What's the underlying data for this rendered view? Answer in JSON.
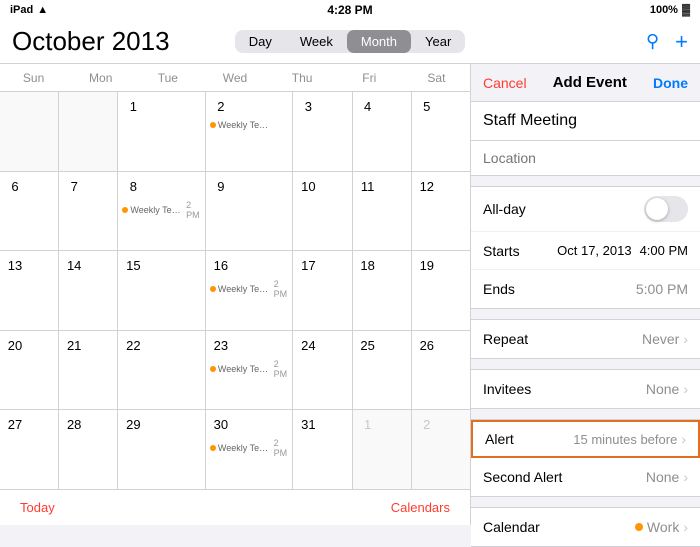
{
  "statusBar": {
    "carrier": "iPad",
    "wifi": "wifi",
    "time": "4:28 PM",
    "battery": "100%"
  },
  "header": {
    "monthTitle": "October 2013",
    "viewButtons": [
      "Day",
      "Week",
      "Month",
      "Year"
    ],
    "activeView": "Month"
  },
  "dayHeaders": [
    "Sun",
    "Mon",
    "Tue",
    "Wed",
    "Thu",
    "Fri",
    "Sat"
  ],
  "calendarRows": [
    [
      {
        "num": "",
        "otherMonth": true
      },
      {
        "num": "",
        "otherMonth": true
      },
      {
        "num": "1",
        "events": []
      },
      {
        "num": "2",
        "events": [
          {
            "text": "Weekly Team...",
            "time": ""
          }
        ]
      },
      {
        "num": "3",
        "events": []
      },
      {
        "num": "4",
        "events": []
      },
      {
        "num": "5",
        "events": []
      }
    ],
    [
      {
        "num": "6",
        "events": []
      },
      {
        "num": "7",
        "events": []
      },
      {
        "num": "8",
        "events": [
          {
            "text": "Weekly Team Me...",
            "time": "2 PM"
          }
        ]
      },
      {
        "num": "9",
        "events": []
      },
      {
        "num": "10",
        "events": []
      },
      {
        "num": "11",
        "events": []
      },
      {
        "num": "12",
        "events": []
      }
    ],
    [
      {
        "num": "13",
        "events": []
      },
      {
        "num": "14",
        "events": []
      },
      {
        "num": "15",
        "events": []
      },
      {
        "num": "16",
        "events": [
          {
            "text": "Weekly Team Me...",
            "time": "2 PM"
          }
        ]
      },
      {
        "num": "17",
        "events": []
      },
      {
        "num": "18",
        "events": []
      },
      {
        "num": "19",
        "events": []
      }
    ],
    [
      {
        "num": "20",
        "events": []
      },
      {
        "num": "21",
        "events": []
      },
      {
        "num": "22",
        "events": []
      },
      {
        "num": "23",
        "events": [
          {
            "text": "Weekly Team Me...",
            "time": "2 PM"
          }
        ]
      },
      {
        "num": "24",
        "events": []
      },
      {
        "num": "25",
        "events": []
      },
      {
        "num": "26",
        "events": []
      }
    ],
    [
      {
        "num": "27",
        "events": []
      },
      {
        "num": "28",
        "events": []
      },
      {
        "num": "29",
        "events": []
      },
      {
        "num": "30",
        "events": [
          {
            "text": "Weekly Team Me...",
            "time": "2 PM"
          }
        ]
      },
      {
        "num": "31",
        "events": []
      },
      {
        "num": "1",
        "otherMonth": true,
        "events": []
      },
      {
        "num": "2",
        "otherMonth": true,
        "events": []
      }
    ]
  ],
  "bottomBar": {
    "todayLabel": "Today",
    "calendarsLabel": "Calendars"
  },
  "eventPanel": {
    "cancelLabel": "Cancel",
    "titleLabel": "Add Event",
    "doneLabel": "Done",
    "eventTitle": "Staff Meeting",
    "locationPlaceholder": "Location",
    "allDayLabel": "All-day",
    "startsLabel": "Starts",
    "startsDate": "Oct 17, 2013",
    "startsTime": "4:00 PM",
    "endsLabel": "Ends",
    "endsTime": "5:00 PM",
    "repeatLabel": "Repeat",
    "repeatValue": "Never",
    "inviteesLabel": "Invitees",
    "inviteesValue": "None",
    "alertLabel": "Alert",
    "alertValue": "15 minutes before",
    "secondAlertLabel": "Second Alert",
    "secondAlertValue": "None",
    "calendarLabel": "Calendar",
    "calendarValue": "Work"
  }
}
